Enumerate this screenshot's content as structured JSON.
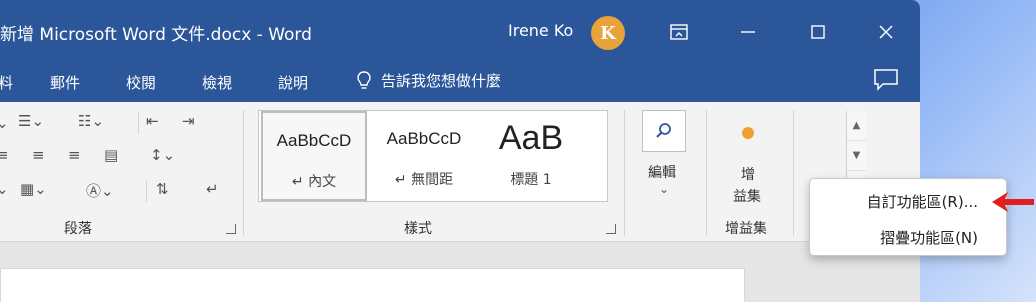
{
  "window": {
    "title": "新增 Microsoft Word 文件.docx  -  Word",
    "user_name": "Irene Ko",
    "avatar_letter": "K"
  },
  "tabs": [
    {
      "label": "料"
    },
    {
      "label": "郵件"
    },
    {
      "label": "校閱"
    },
    {
      "label": "檢視"
    },
    {
      "label": "說明"
    }
  ],
  "tell_me": "告訴我您想做什麼",
  "ribbon": {
    "paragraph_label": "段落",
    "styles_label": "樣式",
    "editing_label": "編輯",
    "addins_button_label_1": "增",
    "addins_button_label_2": "益集",
    "addins_group_label": "增益集",
    "styles": [
      {
        "preview": "AaBbCcD",
        "name": "↵ 內文"
      },
      {
        "preview": "AaBbCcD",
        "name": "↵ 無間距"
      },
      {
        "preview": "AaB",
        "name": "標題 1"
      }
    ]
  },
  "context_menu": {
    "items": [
      {
        "label": "自訂功能區(R)..."
      },
      {
        "label": "摺疊功能區(N)"
      }
    ]
  },
  "colors": {
    "titlebar": "#2b579a",
    "addins_dot": "#f0a030",
    "arrow": "#e0201e"
  }
}
